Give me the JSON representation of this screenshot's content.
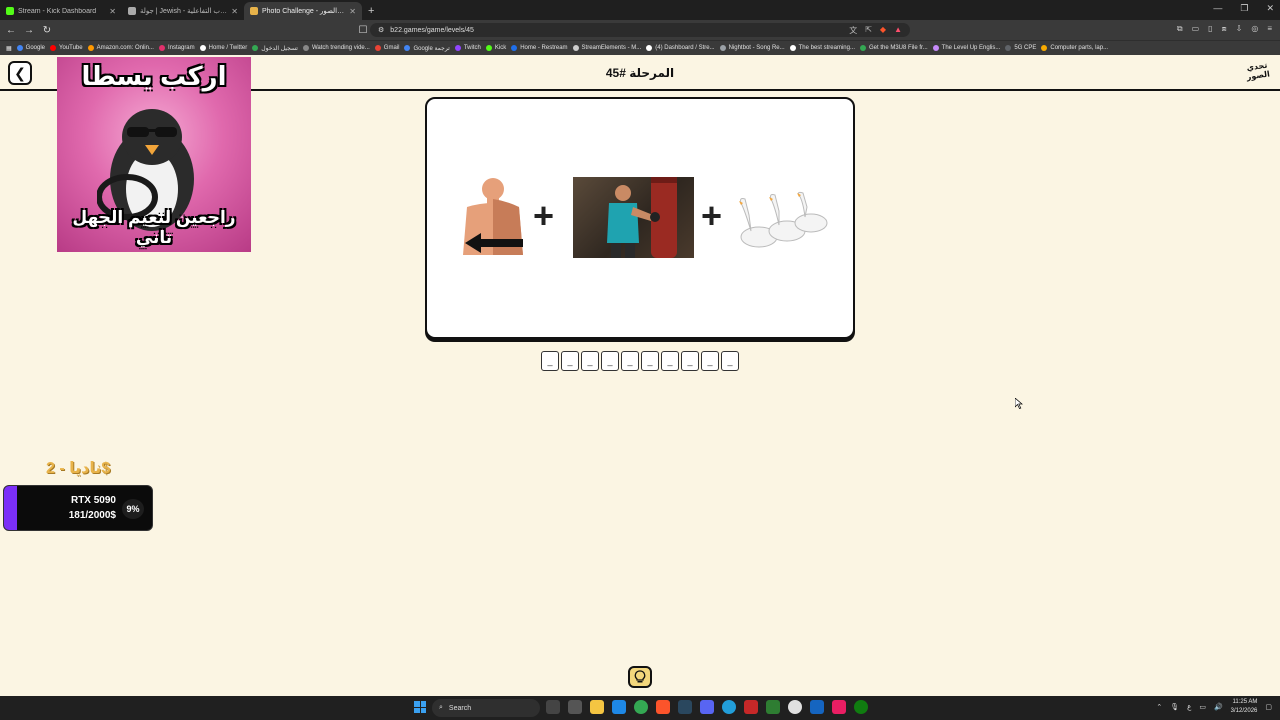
{
  "browser": {
    "tabs": [
      {
        "title": "Stream - Kick Dashboard",
        "color": "#53fc18"
      },
      {
        "title": "جولة | Jewish - منصة الألعاب التفاعلية",
        "color": "#aaaaaa"
      },
      {
        "title": "Photo Challenge - تحدي الصور",
        "color": "#e8b34a",
        "active": true
      }
    ],
    "url": "b22.games/game/levels/45",
    "bookmarks": [
      {
        "label": "Google",
        "color": "#4285f4"
      },
      {
        "label": "YouTube",
        "color": "#ff0000"
      },
      {
        "label": "Amazon.com: Onlin...",
        "color": "#ff9900"
      },
      {
        "label": "Instagram",
        "color": "#e1306c"
      },
      {
        "label": "Home / Twitter",
        "color": "#ffffff"
      },
      {
        "label": "تسجيل الدخول",
        "color": "#34a853"
      },
      {
        "label": "Watch trending vide...",
        "color": "#888888"
      },
      {
        "label": "Gmail",
        "color": "#ea4335"
      },
      {
        "label": "Google ترجمة",
        "color": "#4285f4"
      },
      {
        "label": "Twitch",
        "color": "#9146ff"
      },
      {
        "label": "Kick",
        "color": "#53fc18"
      },
      {
        "label": "Home - Restream",
        "color": "#1f6feb"
      },
      {
        "label": "StreamElements - M...",
        "color": "#cccccc"
      },
      {
        "label": "(4) Dashboard / Stre...",
        "color": "#ffffff"
      },
      {
        "label": "Nightbot - Song Re...",
        "color": "#9aa0a6"
      },
      {
        "label": "The best streaming...",
        "color": "#ffffff"
      },
      {
        "label": "Get the M3U8 File fr...",
        "color": "#34a853"
      },
      {
        "label": "The Level Up Englis...",
        "color": "#c58af9"
      },
      {
        "label": "5G CPE",
        "color": "#5f6368"
      },
      {
        "label": "Computer parts, lap...",
        "color": "#f9ab00"
      }
    ]
  },
  "header": {
    "level_title": "المرحلة #45",
    "logo_text": "تحدي الصور"
  },
  "meme": {
    "top_text": "اركب يسطا",
    "bottom_text": "راجعين لنعيم الجهل تاني"
  },
  "puzzle": {
    "clue_icons": [
      "back-torso-icon",
      "punch-bag-photo",
      "geese-icon"
    ],
    "answer_slots": [
      "_",
      "_",
      "_",
      "_",
      "_",
      "_",
      "_",
      "_",
      "_",
      "_"
    ]
  },
  "donation": {
    "donor_line": "ناديا - 2$",
    "goal_name": "RTX 5090",
    "goal_amount": "181/2000$",
    "goal_percent_label": "9%",
    "goal_fraction": 0.09,
    "bar_color": "#7b2ff7"
  },
  "taskbar": {
    "search_label": "Search",
    "time": "11:25 AM",
    "date": "3/12/2026"
  }
}
